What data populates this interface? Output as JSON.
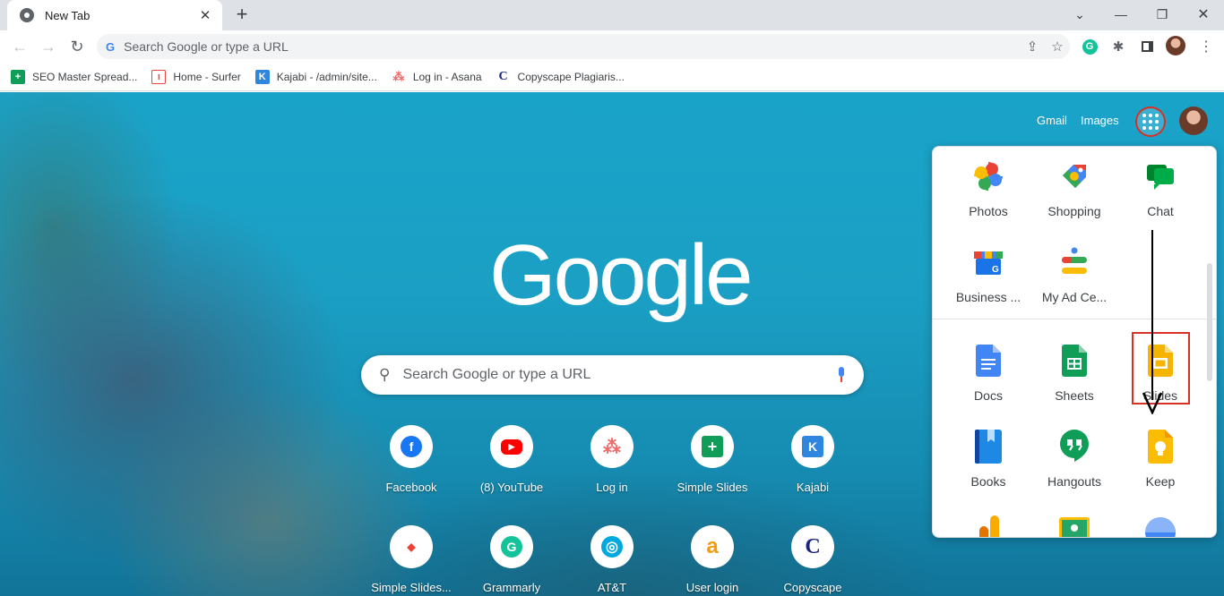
{
  "browser": {
    "tab_title": "New Tab",
    "omnibox_text": "Search Google or type a URL"
  },
  "bookmarks": [
    {
      "label": "SEO Master Spread...",
      "icon": "sheets-icon",
      "color": "#0f9d58"
    },
    {
      "label": "Home - Surfer",
      "icon": "surfer-icon",
      "color": "#e8453c"
    },
    {
      "label": "Kajabi - /admin/site...",
      "icon": "kajabi-icon",
      "color": "#2e86de"
    },
    {
      "label": "Log in - Asana",
      "icon": "asana-icon",
      "color": "#f06a6a"
    },
    {
      "label": "Copyscape Plagiaris...",
      "icon": "copyscape-icon",
      "color": "#1a237e"
    }
  ],
  "header": {
    "gmail": "Gmail",
    "images": "Images"
  },
  "logo": "Google",
  "search": {
    "placeholder": "Search Google or type a URL"
  },
  "shortcuts": [
    {
      "label": "Facebook",
      "icon": "facebook-icon",
      "color": "#1877f2",
      "glyph": "f"
    },
    {
      "label": "(8) YouTube",
      "icon": "youtube-icon",
      "color": "#ff0000",
      "glyph": "▶"
    },
    {
      "label": "Log in",
      "icon": "asana-icon",
      "color": "#f06a6a",
      "glyph": "⁂"
    },
    {
      "label": "Simple Slides",
      "icon": "simple-slides-icon",
      "color": "#0f9d58",
      "glyph": "+"
    },
    {
      "label": "Kajabi",
      "icon": "kajabi-icon",
      "color": "#2e86de",
      "glyph": "K"
    },
    {
      "label": "Simple Slides...",
      "icon": "simple-slides-red-icon",
      "color": "#ea4335",
      "glyph": "◆"
    },
    {
      "label": "Grammarly",
      "icon": "grammarly-icon",
      "color": "#15c39a",
      "glyph": "G"
    },
    {
      "label": "AT&T",
      "icon": "att-icon",
      "color": "#00a8e0",
      "glyph": "◎"
    },
    {
      "label": "User login",
      "icon": "user-login-icon",
      "color": "#f39c12",
      "glyph": "a"
    },
    {
      "label": "Copyscape",
      "icon": "copyscape-icon",
      "color": "#1a237e",
      "glyph": "C"
    }
  ],
  "apps_panel": {
    "apps": [
      {
        "label": "Photos",
        "icon": "photos-icon"
      },
      {
        "label": "Shopping",
        "icon": "shopping-icon"
      },
      {
        "label": "Chat",
        "icon": "chat-icon"
      },
      {
        "label": "Business ...",
        "icon": "business-profile-icon"
      },
      {
        "label": "My Ad Ce...",
        "icon": "ad-center-icon"
      },
      {
        "label": "Docs",
        "icon": "docs-icon"
      },
      {
        "label": "Sheets",
        "icon": "sheets-icon"
      },
      {
        "label": "Slides",
        "icon": "slides-icon"
      },
      {
        "label": "Books",
        "icon": "books-icon"
      },
      {
        "label": "Hangouts",
        "icon": "hangouts-icon"
      },
      {
        "label": "Keep",
        "icon": "keep-icon"
      }
    ]
  }
}
